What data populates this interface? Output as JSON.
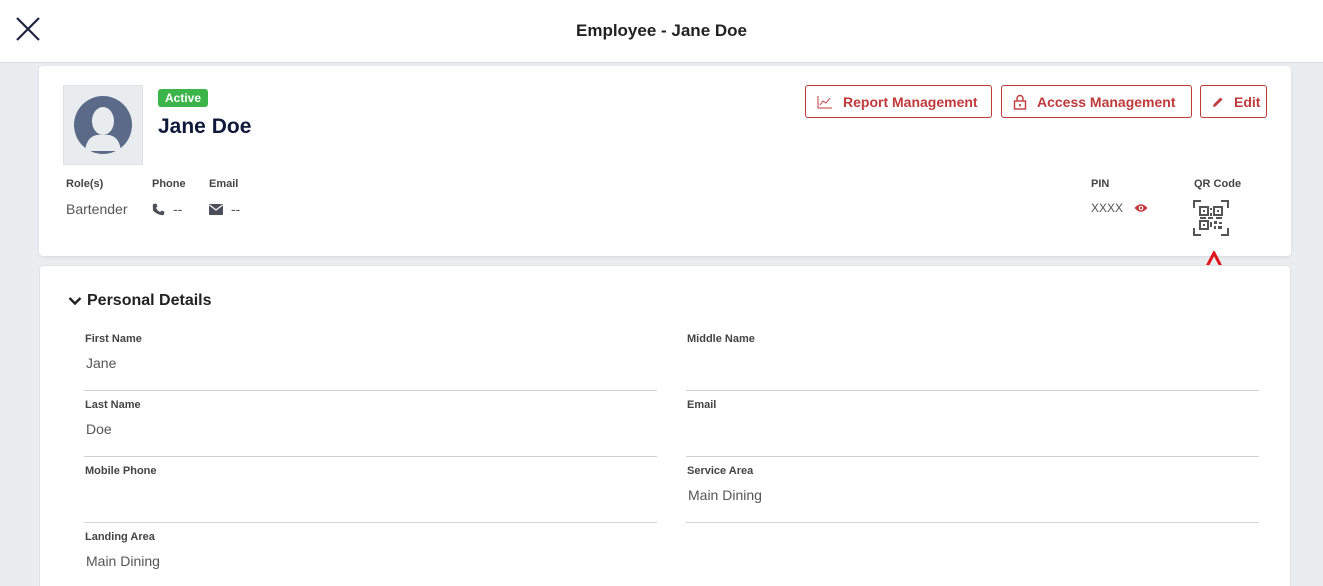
{
  "window": {
    "title": "Employee - Jane Doe"
  },
  "employee": {
    "status": "Active",
    "name": "Jane Doe",
    "role_label": "Role(s)",
    "role": "Bartender",
    "phone_label": "Phone",
    "phone": "--",
    "email_label": "Email",
    "email": "--",
    "pin_label": "PIN",
    "pin": "XXXX",
    "qr_label": "QR Code"
  },
  "actions": {
    "report": "Report Management",
    "access": "Access Management",
    "edit": "Edit"
  },
  "personal_details": {
    "title": "Personal Details",
    "fields": [
      {
        "label": "First Name",
        "value": "Jane"
      },
      {
        "label": "Middle Name",
        "value": ""
      },
      {
        "label": "Last Name",
        "value": "Doe"
      },
      {
        "label": "Email",
        "value": ""
      },
      {
        "label": "Mobile Phone",
        "value": ""
      },
      {
        "label": "Service Area",
        "value": "Main Dining"
      },
      {
        "label": "Landing Area",
        "value": "Main Dining"
      }
    ]
  },
  "colors": {
    "accent": "#c0393b",
    "status_active": "#3bb54a",
    "annotation_arrow": "#e0161c"
  },
  "icons": [
    "close-icon",
    "user-avatar-icon",
    "chart-icon",
    "lock-icon",
    "pencil-icon",
    "phone-icon",
    "envelope-icon",
    "eye-icon",
    "qr-code-icon",
    "chevron-down-icon",
    "up-arrow-annotation"
  ]
}
